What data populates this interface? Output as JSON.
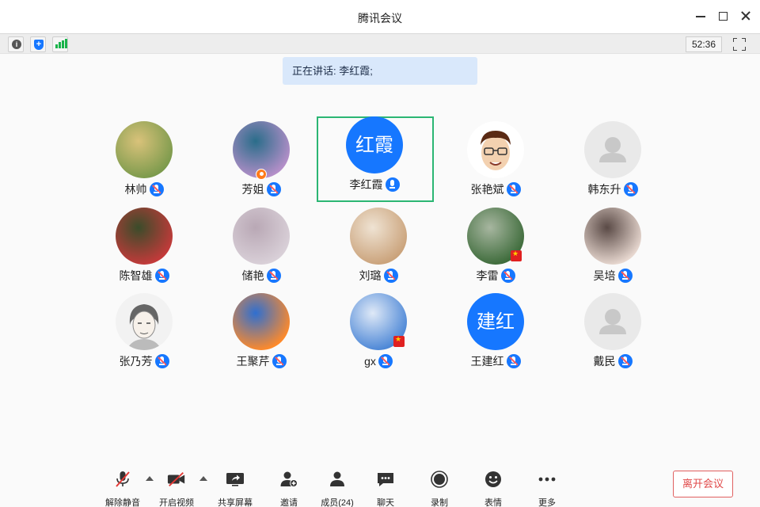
{
  "window": {
    "title": "腾讯会议"
  },
  "status": {
    "timer": "52:36"
  },
  "speaking": {
    "prefix": "正在讲话: ",
    "name": "李红霞;"
  },
  "participants": [
    {
      "name": "林帅",
      "avatar": "photo",
      "colors": [
        "#7b9a4c",
        "#d9c27a"
      ]
    },
    {
      "name": "芳姐",
      "avatar": "photo",
      "colors": [
        "#b58fc9",
        "#2a6d8a"
      ],
      "host": true
    },
    {
      "name": "李红霞",
      "avatar_text": "红霞",
      "colors": [
        "#1677ff",
        "#1677ff"
      ],
      "active": true
    },
    {
      "name": "张艳斌",
      "avatar": "cartoon",
      "colors": [
        "#f3d1b0",
        "#ffffff"
      ]
    },
    {
      "name": "韩东升",
      "avatar": "default",
      "colors": [
        "#e9e9e9",
        "#e9e9e9"
      ]
    },
    {
      "name": "陈智雄",
      "avatar": "photo",
      "colors": [
        "#c43a3a",
        "#3a4c2a"
      ]
    },
    {
      "name": "储艳",
      "avatar": "photo",
      "colors": [
        "#d9d0d8",
        "#b9a8b5"
      ]
    },
    {
      "name": "刘璐",
      "avatar": "photo",
      "colors": [
        "#caa27a",
        "#efe3d3"
      ]
    },
    {
      "name": "李雷",
      "avatar": "photo",
      "colors": [
        "#3d6b3a",
        "#a7b6a0"
      ],
      "flag": true
    },
    {
      "name": "吴培",
      "avatar": "photo",
      "colors": [
        "#e8d8d0",
        "#5a4a46"
      ]
    },
    {
      "name": "张乃芳",
      "avatar": "sketch",
      "colors": [
        "#f2f2f2",
        "#9a9a9a"
      ]
    },
    {
      "name": "王聚芹",
      "avatar": "photo",
      "colors": [
        "#ff8a2a",
        "#2f6fd0"
      ]
    },
    {
      "name": "gx",
      "avatar": "photo",
      "colors": [
        "#4b86d6",
        "#dfe9f7"
      ],
      "flag": true
    },
    {
      "name": "王建红",
      "avatar_text": "建红",
      "colors": [
        "#1677ff",
        "#1677ff"
      ]
    },
    {
      "name": "戴民",
      "avatar": "default",
      "colors": [
        "#e9e9e9",
        "#e9e9e9"
      ]
    }
  ],
  "toolbar": {
    "mute": "解除静音",
    "video": "开启视频",
    "share": "共享屏幕",
    "invite": "邀请",
    "members": "成员(24)",
    "chat": "聊天",
    "record": "录制",
    "emoji": "表情",
    "more": "更多"
  },
  "leave": "离开会议",
  "colors": {
    "accent": "#1677ff",
    "active_border": "#2bb673",
    "leave": "#e04848",
    "host_badge": "#ff7a1a"
  }
}
